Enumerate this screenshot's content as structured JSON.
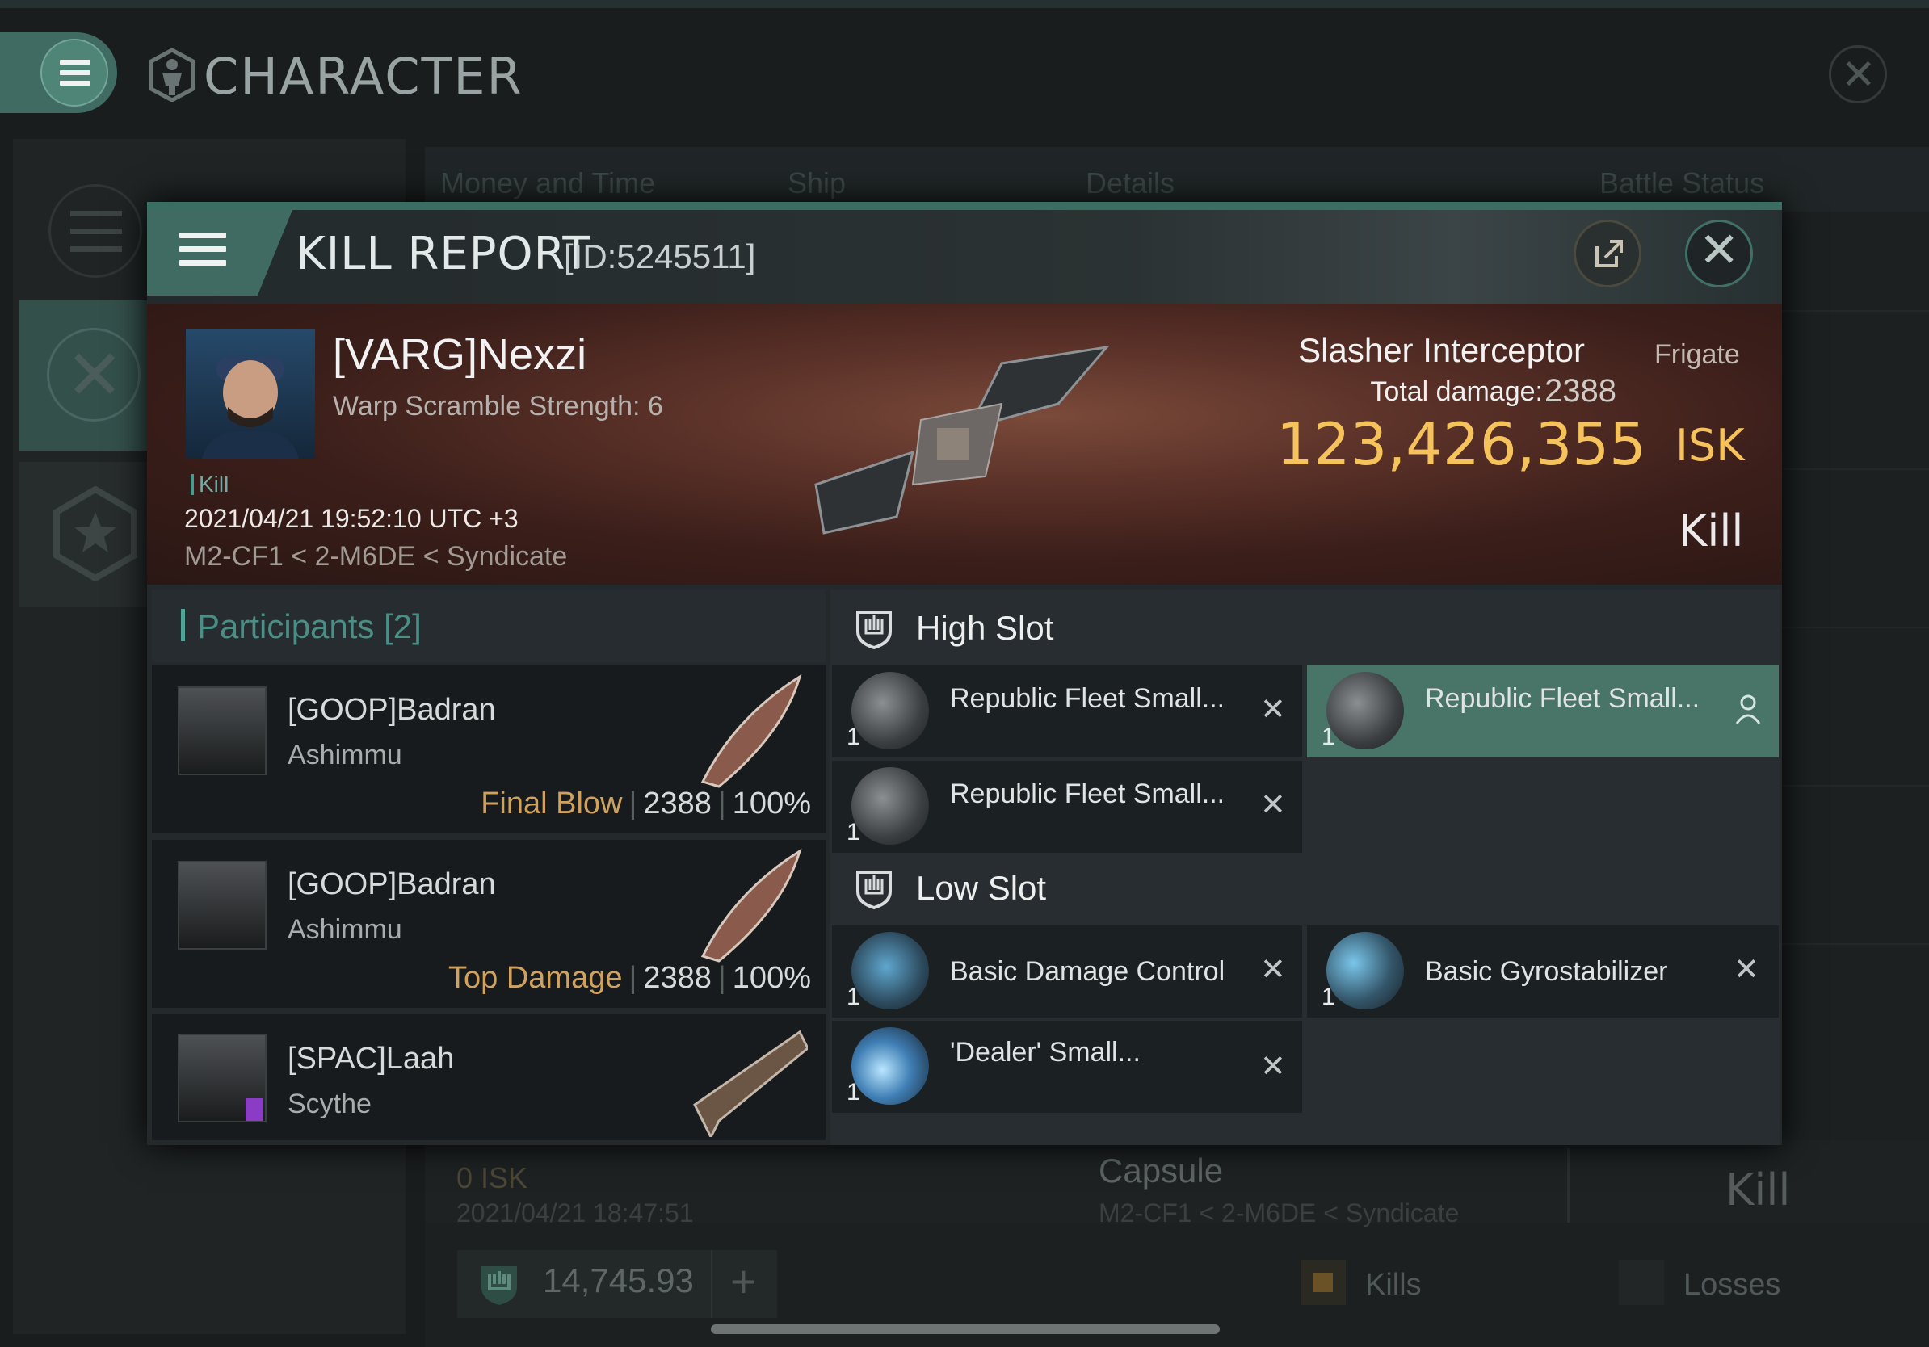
{
  "header": {
    "title": "CHARACTER"
  },
  "background": {
    "tabs": [
      "Money and Time",
      "Ship",
      "Details",
      "Battle Status"
    ],
    "row": {
      "isk": "0  ISK",
      "date": "2021/04/21  18:47:51",
      "ship": "Capsule",
      "location": "M2-CF1 < 2-M6DE < Syndicate",
      "status": "Kill"
    },
    "wallet": {
      "value": "14,745.93"
    },
    "filters": {
      "kills": "Kills",
      "losses": "Losses"
    }
  },
  "kill_report": {
    "title": "KILL REPORT",
    "id": "[ID:5245511]",
    "victim": {
      "pilot": "[VARG]Nexzi",
      "warp_scramble": "Warp Scramble Strength: 6",
      "tag": "Kill",
      "date": "2021/04/21 19:52:10 UTC +3",
      "location": "M2-CF1 < 2-M6DE < Syndicate",
      "ship_name": "Slasher Interceptor",
      "ship_class": "Frigate",
      "total_damage_label": "Total damage:",
      "total_damage": "2388",
      "isk_value": "123,426,355",
      "isk_unit": "ISK",
      "status": "Kill"
    },
    "participants": {
      "label": "Participants",
      "count": "[2]",
      "rows": [
        {
          "name": "[GOOP]Badran",
          "ship": "Ashimmu",
          "role": "Final Blow",
          "damage": "2388",
          "percent": "100%"
        },
        {
          "name": "[GOOP]Badran",
          "ship": "Ashimmu",
          "role": "Top Damage",
          "damage": "2388",
          "percent": "100%"
        },
        {
          "name": "[SPAC]Laah",
          "ship": "Scythe"
        }
      ]
    },
    "slots": {
      "high": {
        "label": "High Slot",
        "items": [
          {
            "name": "Republic Fleet Small...",
            "qty": "1"
          },
          {
            "name": "Republic Fleet Small...",
            "qty": "1"
          },
          {
            "name": "Republic Fleet Small...",
            "qty": "1"
          }
        ]
      },
      "low": {
        "label": "Low Slot",
        "items": [
          {
            "name": "Basic Damage Control",
            "qty": "1"
          },
          {
            "name": "Basic Gyrostabilizer",
            "qty": "1"
          },
          {
            "name": "'Dealer' Small...",
            "qty": "1"
          }
        ]
      }
    }
  }
}
